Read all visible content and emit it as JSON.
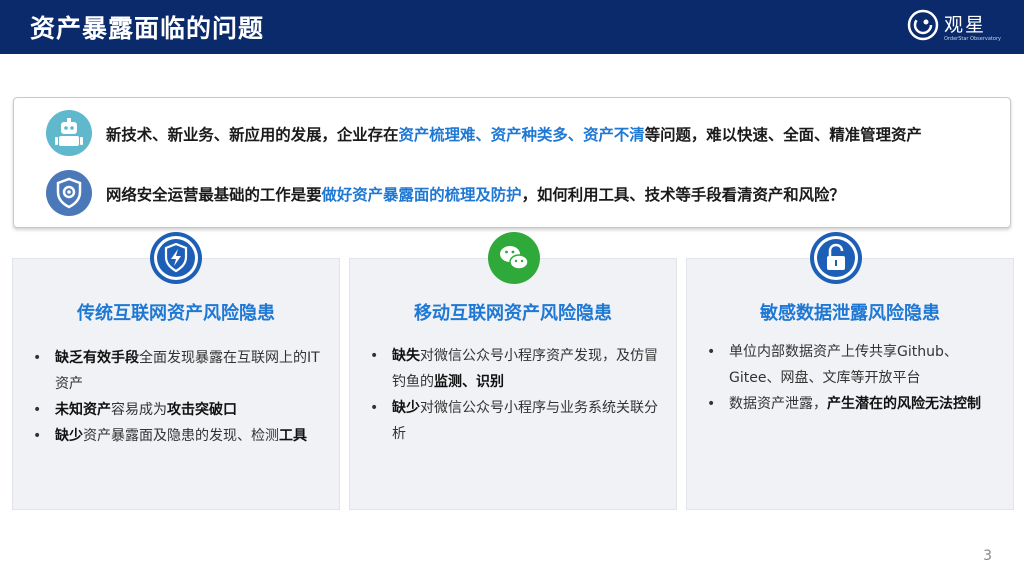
{
  "header": {
    "title": "资产暴露面临的问题",
    "logo_name": "观星",
    "logo_sub": "OrderStar Observatory"
  },
  "intro": {
    "row1": {
      "p1": "新技术、新业务、新应用的发展，企业存在",
      "h1": "资产梳理难、资产种类多、资产不清",
      "p2": "等问题，难以快速、全面、精准管理资产"
    },
    "row2": {
      "p1": "网络安全运营最基础的工作是要",
      "h1": "做好资产暴露面的梳理及防护",
      "p2": "，如何利用工具、技术等手段看清资产和风险？"
    }
  },
  "cards": [
    {
      "title": "传统互联网资产风险隐患",
      "items": [
        {
          "b1": "缺乏有效手段",
          "t1": "全面发现暴露在互联网上的IT资产",
          "b2": "",
          "t2": ""
        },
        {
          "b1": "未知资产",
          "t1": "容易成为",
          "b2": "攻击突破口",
          "t2": ""
        },
        {
          "b1": "缺少",
          "t1": "资产暴露面及隐患的发现、检测",
          "b2": "工具",
          "t2": ""
        }
      ]
    },
    {
      "title": "移动互联网资产风险隐患",
      "items": [
        {
          "b1": "缺失",
          "t1": "对微信公众号小程序资产发现，及仿冒钓鱼的",
          "b2": "监测、识别",
          "t2": ""
        },
        {
          "b1": "缺少",
          "t1": "对微信公众号小程序与业务系统关联分析",
          "b2": "",
          "t2": ""
        }
      ]
    },
    {
      "title": "敏感数据泄露风险隐患",
      "items": [
        {
          "b1": "",
          "t1": "单位内部数据资产上传共享Github、Gitee、网盘、文库等开放平台",
          "b2": "",
          "t2": ""
        },
        {
          "b1": "",
          "t1": "数据资产泄露，",
          "b2": "产生潜在的风险无法控制",
          "t2": ""
        }
      ]
    }
  ],
  "page_number": "3",
  "icons": {
    "intro1": "robot-tech-icon",
    "intro2": "shield-gear-icon",
    "card1": "shield-lightning-icon",
    "card2": "wechat-icon",
    "card3": "unlocked-padlock-icon"
  },
  "colors": {
    "header_bg": "#0a2a6b",
    "highlight": "#1f78d4",
    "card_bg": "#f0f2f5",
    "wechat_green": "#2faa3a",
    "icon_blue": "#1d5fb6"
  }
}
